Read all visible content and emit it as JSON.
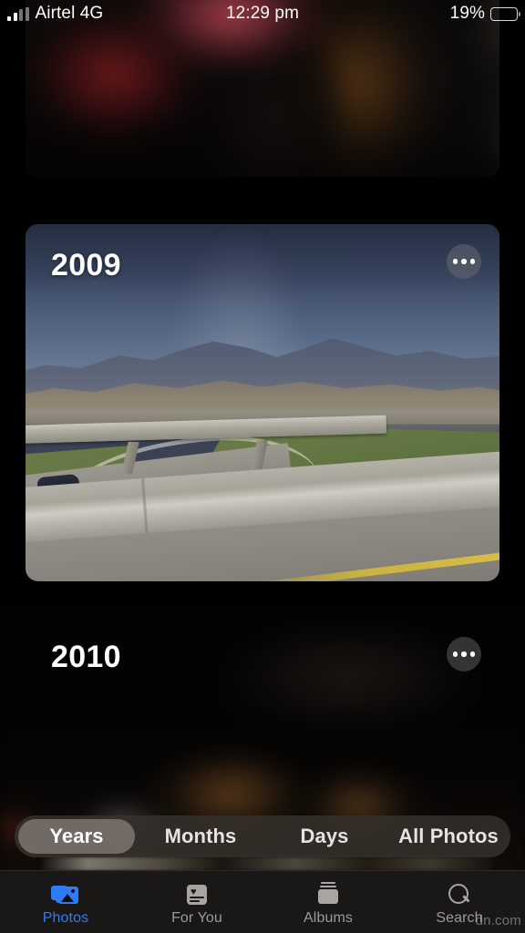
{
  "status_bar": {
    "carrier": "Airtel 4G",
    "time": "12:29 pm",
    "battery_percent": "19%",
    "battery_color": "#f5c518",
    "signal_icon": "cellular-signal-icon",
    "battery_icon": "battery-low-icon"
  },
  "library": {
    "cards": [
      {
        "year": "",
        "more_label": "",
        "description": "dark blurred photo of people"
      },
      {
        "year": "2009",
        "more_label": "",
        "description": "highway overpass with mountains"
      },
      {
        "year": "2010",
        "more_label": "",
        "description": "very dark blurred photo"
      }
    ]
  },
  "segmented_control": {
    "selected": "Years",
    "options": [
      {
        "label": "Years",
        "selected": true
      },
      {
        "label": "Months",
        "selected": false
      },
      {
        "label": "Days",
        "selected": false
      },
      {
        "label": "All Photos",
        "selected": false
      }
    ]
  },
  "tab_bar": {
    "active": "Photos",
    "active_color": "#2f7cf6",
    "inactive_color": "#9d9a96",
    "tabs": [
      {
        "label": "Photos",
        "icon": "photos-stack-icon",
        "active": true
      },
      {
        "label": "For You",
        "icon": "heart-card-icon",
        "active": false
      },
      {
        "label": "Albums",
        "icon": "albums-stack-icon",
        "active": false
      },
      {
        "label": "Search",
        "icon": "magnifier-icon",
        "active": false
      }
    ]
  },
  "watermark": {
    "text": "dn.com"
  }
}
